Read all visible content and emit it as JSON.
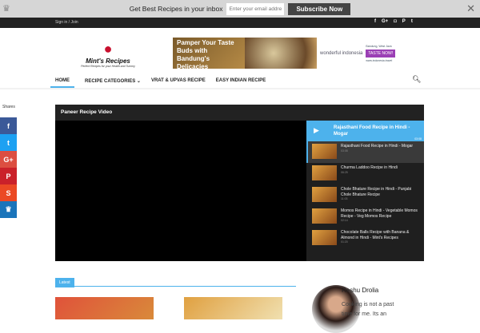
{
  "subscribe_bar": {
    "text": "Get Best Recipes in your inbox",
    "email_placeholder": "Enter your email address",
    "button": "Subscribe Now"
  },
  "topbar": {
    "signin": "Sign in / Join",
    "social": [
      "f",
      "G+",
      "◘",
      "P",
      "t"
    ]
  },
  "logo": {
    "name": "Mint's Recipes",
    "tagline": "Perfect Recipes for your Health and Tummy"
  },
  "ad": {
    "headline": "Pamper Your Taste Buds with Bandung's Delicacies",
    "brand": "wonderful indonesia",
    "location": "Bandung, West Java",
    "cta": "TASTE NOW!",
    "url": "www.indonesia.travel"
  },
  "nav": {
    "items": [
      "HOME",
      "RECIPE CATEGORIES ⌄",
      "VRAT & UPVAS RECIPE",
      "EASY INDIAN RECIPE"
    ]
  },
  "shares": {
    "label": "Shares",
    "buttons": [
      {
        "icon": "f",
        "color": "#3b5998"
      },
      {
        "icon": "t",
        "color": "#1da1f2"
      },
      {
        "icon": "G+",
        "color": "#dc4e41"
      },
      {
        "icon": "P",
        "color": "#ca212a"
      },
      {
        "icon": "S",
        "color": "#eb4924"
      },
      {
        "icon": "♛",
        "color": "#1a74ba"
      }
    ]
  },
  "player": {
    "title": "Paneer Recipe Video",
    "now_playing": {
      "title": "Rajasthani Food Recipe in Hindi - Mogar",
      "duration": "03:08"
    },
    "videos": [
      {
        "title": "Rajasthani Food Recipe in Hindi - Mogar",
        "duration": "03:08"
      },
      {
        "title": "Churma Laddoo Recipe in Hindi",
        "duration": "06:25"
      },
      {
        "title": "Chole Bhature Recipe in Hindi - Punjabi Chole Bhature Recipe",
        "duration": "11:03"
      },
      {
        "title": "Momos Recipe in Hindi - Vegetable Momos Recipe - Veg Momos Recipe",
        "duration": "02:14"
      },
      {
        "title": "Chocolate Balls Recipe with Banana & Almond in Hindi - Mint's Recipes",
        "duration": "01:20"
      }
    ]
  },
  "latest": {
    "label": "Latest"
  },
  "author": {
    "name": "Reshu Drolia",
    "bio": "Cooking is not a past time for me. Its an"
  }
}
